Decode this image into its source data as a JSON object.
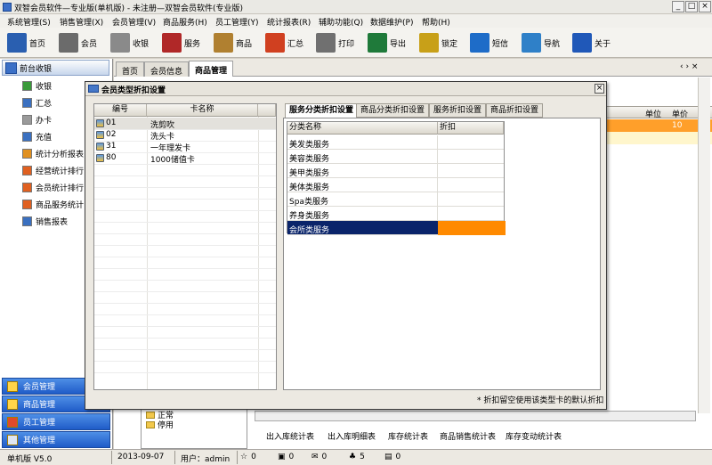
{
  "window": {
    "title": "双智会员软件—专业版(单机版) - 未注册—双智会员软件(专业版)"
  },
  "menu": [
    "系统管理(S)",
    "销售管理(X)",
    "会员管理(V)",
    "商品服务(H)",
    "员工管理(Y)",
    "统计报表(R)",
    "辅助功能(Q)",
    "数据维护(P)",
    "帮助(H)"
  ],
  "toolbar": [
    {
      "label": "首页",
      "icon": "monitor-icon",
      "color": "#2a5fb0"
    },
    {
      "label": "会员",
      "icon": "card-icon",
      "color": "#6b6b6b"
    },
    {
      "label": "收银",
      "icon": "calculator-icon",
      "color": "#8a8a8a"
    },
    {
      "label": "服务",
      "icon": "books-icon",
      "color": "#b02828"
    },
    {
      "label": "商品",
      "icon": "box-icon",
      "color": "#b08030"
    },
    {
      "label": "汇总",
      "icon": "bar-chart-icon",
      "color": "#d04020"
    },
    {
      "label": "打印",
      "icon": "printer-icon",
      "color": "#707070"
    },
    {
      "label": "导出",
      "icon": "excel-icon",
      "color": "#1f7a3a"
    },
    {
      "label": "锁定",
      "icon": "lock-icon",
      "color": "#c8a018"
    },
    {
      "label": "短信",
      "icon": "phone-icon",
      "color": "#1e6cc8"
    },
    {
      "label": "导航",
      "icon": "org-chart-icon",
      "color": "#2f80c8"
    },
    {
      "label": "关于",
      "icon": "info-icon",
      "color": "#2058b8"
    }
  ],
  "left": {
    "header": "前台收银",
    "items": [
      {
        "label": "收银",
        "icon": "cart-icon",
        "color": "#3a9a3a"
      },
      {
        "label": "汇总",
        "icon": "sum-icon",
        "color": "#3a70c0"
      },
      {
        "label": "办卡",
        "icon": "card-icon",
        "color": "#9a9a9a"
      },
      {
        "label": "充值",
        "icon": "money-icon",
        "color": "#3a70c0"
      },
      {
        "label": "统计分析报表",
        "icon": "bar-chart-icon",
        "color": "#e09020"
      },
      {
        "label": "经营统计排行",
        "icon": "bar-chart-icon",
        "color": "#e06020"
      },
      {
        "label": "会员统计排行",
        "icon": "bar-chart-icon",
        "color": "#e06020"
      },
      {
        "label": "商品服务统计",
        "icon": "bar-chart-icon",
        "color": "#e06020"
      },
      {
        "label": "销售报表",
        "icon": "table-icon",
        "color": "#3a70c0"
      }
    ],
    "nav": [
      "会员管理",
      "商品管理",
      "员工管理",
      "其他管理"
    ]
  },
  "tabs": [
    "首页",
    "会员信息",
    "商品管理"
  ],
  "background": {
    "col_unit": "单位",
    "col_price": "单价",
    "price_val": "10",
    "tree_items": [
      "正常",
      "停用"
    ],
    "bottom_tabs": [
      "出入库统计表",
      "出入库明细表",
      "库存统计表",
      "商品销售统计表",
      "库存变动统计表"
    ]
  },
  "dialog": {
    "title": "会员类型折扣设置",
    "left_headers": [
      "编号",
      "卡名称"
    ],
    "cards": [
      {
        "id": "01",
        "name": "洗剪吹"
      },
      {
        "id": "02",
        "name": "洗头卡"
      },
      {
        "id": "31",
        "name": "一年理发卡"
      },
      {
        "id": "80",
        "name": "1000储值卡"
      }
    ],
    "tabs": [
      "服务分类折扣设置",
      "商品分类折扣设置",
      "服务折扣设置",
      "商品折扣设置"
    ],
    "right_headers": [
      "分类名称",
      "折扣"
    ],
    "categories": [
      "美发类服务",
      "美容类服务",
      "美甲类服务",
      "美体类服务",
      "Spa类服务",
      "养身类服务",
      "会所类服务"
    ],
    "note": "* 折扣留空使用该类型卡的默认折扣"
  },
  "status": {
    "edition": "单机版 V5.0",
    "date": "2013-09-07",
    "user": "用户：admin",
    "counters": [
      "0",
      "0",
      "0",
      "5",
      "0"
    ]
  }
}
